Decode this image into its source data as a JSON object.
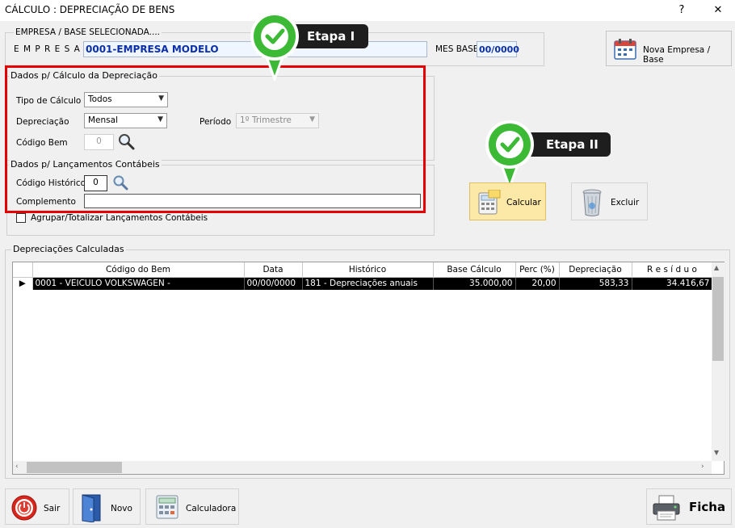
{
  "window": {
    "title": "CÁLCULO : DEPRECIAÇÃO DE BENS",
    "help_glyph": "?",
    "close_glyph": "✕"
  },
  "empresa": {
    "section_label": "EMPRESA  /  BASE  SELECIONADA....",
    "empresa_label": "E M P R E S A",
    "empresa_value": "0001-EMPRESA MODELO",
    "mes_base_label": "MES BASE",
    "mes_base_value": "00/0000",
    "nova_button": "Nova Empresa / Base"
  },
  "calculo": {
    "group_title": "Dados p/ Cálculo da Depreciação",
    "tipo_label": "Tipo de Cálculo",
    "tipo_value": "Todos",
    "depreciacao_label": "Depreciação",
    "depreciacao_value": "Mensal",
    "periodo_label": "Período",
    "periodo_value": "1º Trimestre",
    "codigo_bem_label": "Código Bem",
    "codigo_bem_value": "0"
  },
  "lancamentos": {
    "group_title": "Dados p/ Lançamentos Contábeis",
    "historico_label": "Código Histórico",
    "historico_value": "0",
    "complemento_label": "Complemento",
    "complemento_value": "",
    "agrupar_label": "Agrupar/Totalizar Lançamentos Contábeis"
  },
  "annotations": {
    "etapa1": "Etapa I",
    "etapa2": "Etapa II"
  },
  "actions": {
    "calcular": "Calcular",
    "excluir": "Excluir"
  },
  "grid": {
    "group_title": "Depreciações Calculadas",
    "columns": [
      "Código do Bem",
      "Data",
      "Histórico",
      "Base Cálculo",
      "Perc (%)",
      "Depreciação",
      "R e s í d u o"
    ],
    "rows": [
      {
        "codigo": "0001 - VEICULO VOLKSWAGEN -",
        "data": "00/00/0000",
        "historico": "181 - Depreciações anuais",
        "base": "35.000,00",
        "perc": "20,00",
        "depreciacao": "583,33",
        "residuo": "34.416,67"
      }
    ]
  },
  "footer": {
    "sair": "Sair",
    "novo": "Novo",
    "calculadora": "Calculadora",
    "ficha": "Ficha"
  },
  "colors": {
    "highlight_red": "#e60000",
    "check_green": "#3cb935",
    "value_blue": "#0b2fa8"
  }
}
